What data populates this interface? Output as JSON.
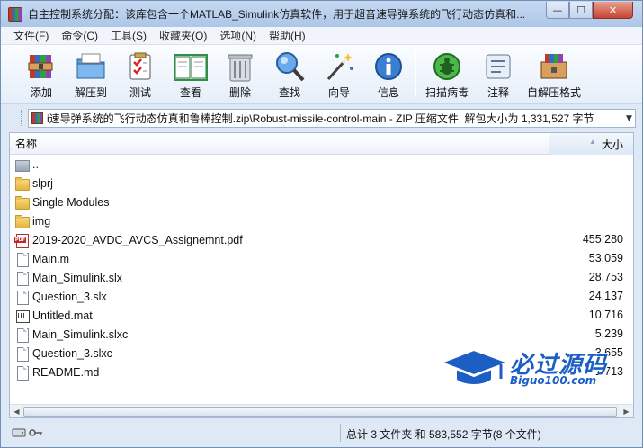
{
  "window": {
    "title": "自主控制系统分配：该库包含一个MATLAB_Simulink仿真软件，用于超音速导弹系统的飞行动态仿真和...",
    "minimize_label": "—",
    "maximize_label": "☐",
    "close_label": "✕"
  },
  "menu": {
    "items": [
      "文件(F)",
      "命令(C)",
      "工具(S)",
      "收藏夹(O)",
      "选项(N)",
      "帮助(H)"
    ]
  },
  "toolbar": {
    "buttons": [
      {
        "label": "添加",
        "icon": "add-archive-icon"
      },
      {
        "label": "解压到",
        "icon": "extract-icon"
      },
      {
        "label": "测试",
        "icon": "test-icon"
      },
      {
        "label": "查看",
        "icon": "view-icon"
      },
      {
        "label": "删除",
        "icon": "trash-icon"
      },
      {
        "label": "查找",
        "icon": "find-icon"
      },
      {
        "label": "向导",
        "icon": "wizard-icon"
      },
      {
        "label": "信息",
        "icon": "info-icon"
      },
      {
        "label": "扫描病毒",
        "icon": "virus-scan-icon"
      },
      {
        "label": "注释",
        "icon": "comment-icon"
      },
      {
        "label": "自解压格式",
        "icon": "sfx-icon"
      }
    ]
  },
  "address": {
    "path": "i速导弹系统的飞行动态仿真和鲁棒控制.zip\\Robust-missile-control-main - ZIP 压缩文件, 解包大小为 1,331,527 字节"
  },
  "filelist": {
    "col_name": "名称",
    "col_size": "大小",
    "rows": [
      {
        "name": "..",
        "size": "",
        "type": "up"
      },
      {
        "name": "slprj",
        "size": "",
        "type": "folder"
      },
      {
        "name": "Single Modules",
        "size": "",
        "type": "folder"
      },
      {
        "name": "img",
        "size": "",
        "type": "folder"
      },
      {
        "name": "2019-2020_AVDC_AVCS_Assignemnt.pdf",
        "size": "455,280",
        "type": "pdf"
      },
      {
        "name": "Main.m",
        "size": "53,059",
        "type": "doc"
      },
      {
        "name": "Main_Simulink.slx",
        "size": "28,753",
        "type": "doc"
      },
      {
        "name": "Question_3.slx",
        "size": "24,137",
        "type": "doc"
      },
      {
        "name": "Untitled.mat",
        "size": "10,716",
        "type": "mat"
      },
      {
        "name": "Main_Simulink.slxc",
        "size": "5,239",
        "type": "doc"
      },
      {
        "name": "Question_3.slxc",
        "size": "3,655",
        "type": "doc"
      },
      {
        "name": "README.md",
        "size": "1,713",
        "type": "doc"
      }
    ]
  },
  "watermark": {
    "title": "必过源码",
    "url": "Biguo100.com"
  },
  "status": {
    "summary": "总计 3 文件夹 和 583,552 字节(8 个文件)"
  },
  "colors": {
    "titlebar": "#b8cfec",
    "accent": "#1b5fc4",
    "close": "#c74431"
  }
}
